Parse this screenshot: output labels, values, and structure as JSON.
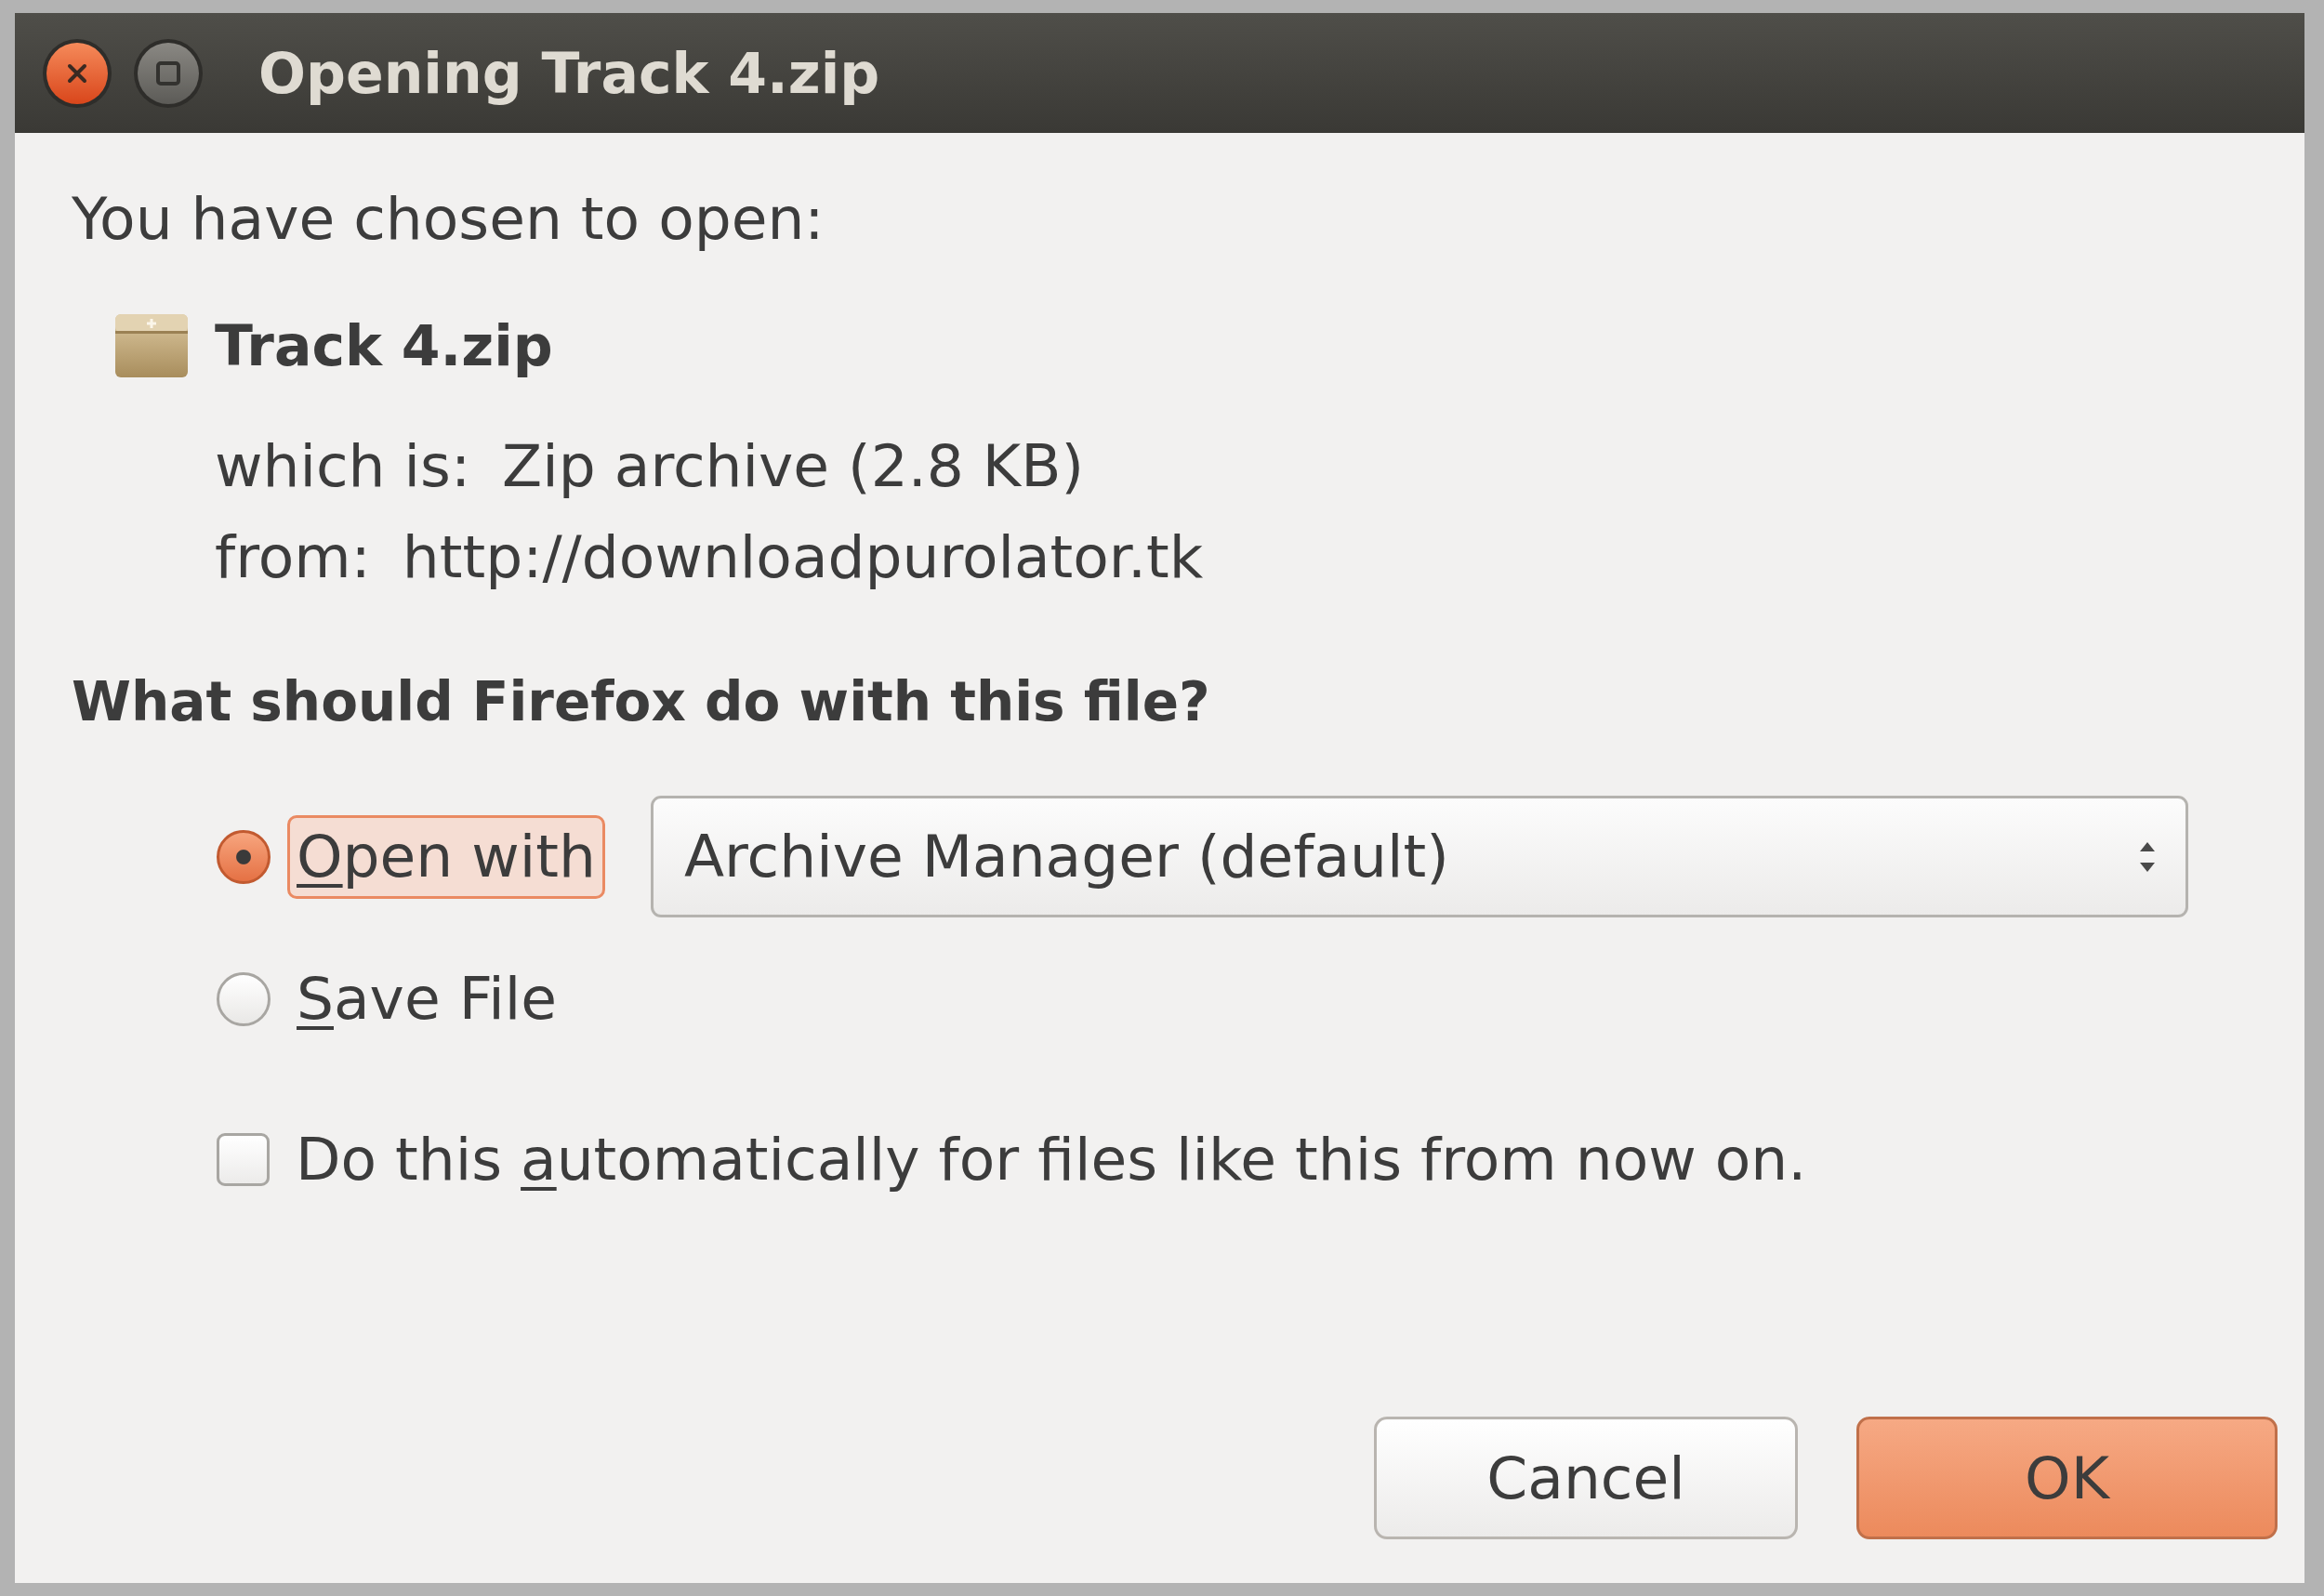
{
  "window": {
    "title": "Opening Track 4.zip"
  },
  "intro": "You have chosen to open:",
  "file": {
    "name": "Track 4.zip",
    "details": [
      {
        "label": "which is:",
        "value": "Zip archive (2.8 KB)"
      },
      {
        "label": "from:",
        "value": "http://downloadpurolator.tk"
      }
    ]
  },
  "question": "What should Firefox do with this file?",
  "actions": [
    {
      "kind": "open_with",
      "access_key": "O",
      "label_rest": "pen with",
      "selected": true,
      "focused": true,
      "application": "Archive Manager (default)"
    },
    {
      "kind": "save",
      "access_key": "S",
      "label_rest": "ave File",
      "selected": false,
      "focused": false
    }
  ],
  "auto_option": {
    "label_start": "Do this ",
    "access_key": "a",
    "label_rest": "utomatically for files like this from now on.",
    "checked": false
  },
  "buttons": [
    {
      "label": "Cancel",
      "kind": "normal"
    },
    {
      "label": "OK",
      "kind": "default"
    }
  ]
}
